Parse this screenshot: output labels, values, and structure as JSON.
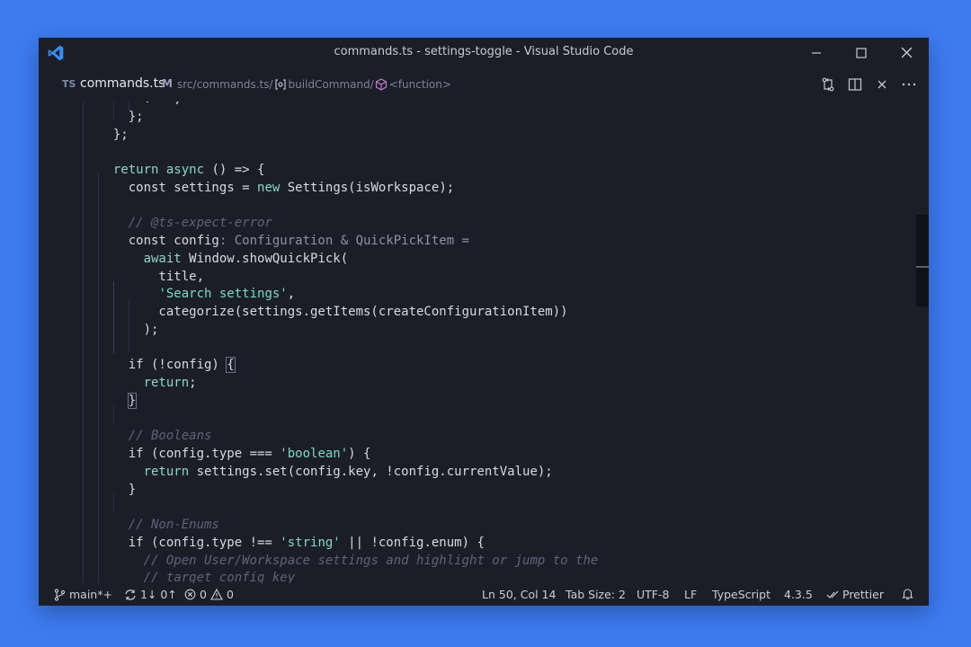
{
  "window": {
    "title": "commands.ts - settings-toggle - Visual Studio Code"
  },
  "tab": {
    "lang_badge": "TS",
    "file_name": "commands.ts",
    "modified_flag": "M",
    "breadcrumbs": [
      "src",
      "commands.ts",
      "buildCommand",
      "<function>"
    ]
  },
  "colors": {
    "background": "#3d7bf0",
    "editor_bg": "#1b1e29",
    "keyword": "#8fd6c4",
    "string": "#7fd8c0",
    "comment": "#5d6478"
  },
  "icons": {
    "app": "vscode-logo-icon",
    "source_control": "git-compare-icon",
    "split": "split-editor-icon",
    "close": "close-icon",
    "more": "ellipsis-icon",
    "breadcrumb_symbol": "symbol-module-icon",
    "breadcrumb_function": "symbol-cube-icon"
  },
  "code": {
    "lines": [
      [
        {
          "t": "      : ``,",
          "c": "plain"
        }
      ],
      [
        {
          "t": "    };",
          "c": "plain"
        }
      ],
      [
        {
          "t": "  };",
          "c": "plain"
        }
      ],
      [
        {
          "t": "",
          "c": "plain"
        }
      ],
      [
        {
          "t": "  ",
          "c": "plain"
        },
        {
          "t": "return",
          "c": "kw"
        },
        {
          "t": " ",
          "c": "plain"
        },
        {
          "t": "async",
          "c": "kw"
        },
        {
          "t": " () => {",
          "c": "plain"
        }
      ],
      [
        {
          "t": "    const settings = ",
          "c": "plain"
        },
        {
          "t": "new",
          "c": "kw"
        },
        {
          "t": " Settings(isWorkspace);",
          "c": "plain"
        }
      ],
      [
        {
          "t": "",
          "c": "plain"
        }
      ],
      [
        {
          "t": "    ",
          "c": "plain"
        },
        {
          "t": "// @ts-expect-error",
          "c": "cm"
        }
      ],
      [
        {
          "t": "    const config",
          "c": "plain"
        },
        {
          "t": ": Configuration & QuickPickItem =",
          "c": "type"
        }
      ],
      [
        {
          "t": "      ",
          "c": "plain"
        },
        {
          "t": "await",
          "c": "kw"
        },
        {
          "t": " Window.showQuickPick(",
          "c": "plain"
        }
      ],
      [
        {
          "t": "        title,",
          "c": "plain"
        }
      ],
      [
        {
          "t": "        ",
          "c": "plain"
        },
        {
          "t": "'Search settings'",
          "c": "str"
        },
        {
          "t": ",",
          "c": "plain"
        }
      ],
      [
        {
          "t": "        categorize(settings.getItems(createConfigurationItem))",
          "c": "plain"
        }
      ],
      [
        {
          "t": "      );",
          "c": "plain"
        }
      ],
      [
        {
          "t": "",
          "c": "plain"
        }
      ],
      [
        {
          "t": "    if (!config) ",
          "c": "plain"
        },
        {
          "t": "{",
          "c": "plain",
          "b": true
        }
      ],
      [
        {
          "t": "      ",
          "c": "plain"
        },
        {
          "t": "return",
          "c": "kw"
        },
        {
          "t": ";",
          "c": "plain"
        }
      ],
      [
        {
          "t": "    ",
          "c": "plain"
        },
        {
          "t": "}",
          "c": "plain",
          "b": true
        }
      ],
      [
        {
          "t": "",
          "c": "plain"
        }
      ],
      [
        {
          "t": "    ",
          "c": "plain"
        },
        {
          "t": "// Booleans",
          "c": "cm"
        }
      ],
      [
        {
          "t": "    if (config.type === ",
          "c": "plain"
        },
        {
          "t": "'boolean'",
          "c": "str"
        },
        {
          "t": ") {",
          "c": "plain"
        }
      ],
      [
        {
          "t": "      ",
          "c": "plain"
        },
        {
          "t": "return",
          "c": "kw"
        },
        {
          "t": " settings.set(config.key, !config.currentValue);",
          "c": "plain"
        }
      ],
      [
        {
          "t": "    }",
          "c": "plain"
        }
      ],
      [
        {
          "t": "",
          "c": "plain"
        }
      ],
      [
        {
          "t": "    ",
          "c": "plain"
        },
        {
          "t": "// Non-Enums",
          "c": "cm"
        }
      ],
      [
        {
          "t": "    if (config.type !== ",
          "c": "plain"
        },
        {
          "t": "'string'",
          "c": "str"
        },
        {
          "t": " || !config.enum) {",
          "c": "plain"
        }
      ],
      [
        {
          "t": "      ",
          "c": "plain"
        },
        {
          "t": "// Open User/Workspace settings and highlight or jump to the",
          "c": "cm"
        }
      ],
      [
        {
          "t": "      ",
          "c": "plain"
        },
        {
          "t": "// target config key",
          "c": "cm"
        }
      ]
    ],
    "current_line_index": 16
  },
  "statusbar": {
    "branch": "main*+",
    "sync": "1↓ 0↑",
    "errors": "0",
    "warnings": "0",
    "cursor": "Ln 50, Col 14",
    "tab_size": "Tab Size: 2",
    "encoding": "UTF-8",
    "eol": "LF",
    "language": "TypeScript",
    "version": "4.3.5",
    "formatter": "Prettier"
  }
}
